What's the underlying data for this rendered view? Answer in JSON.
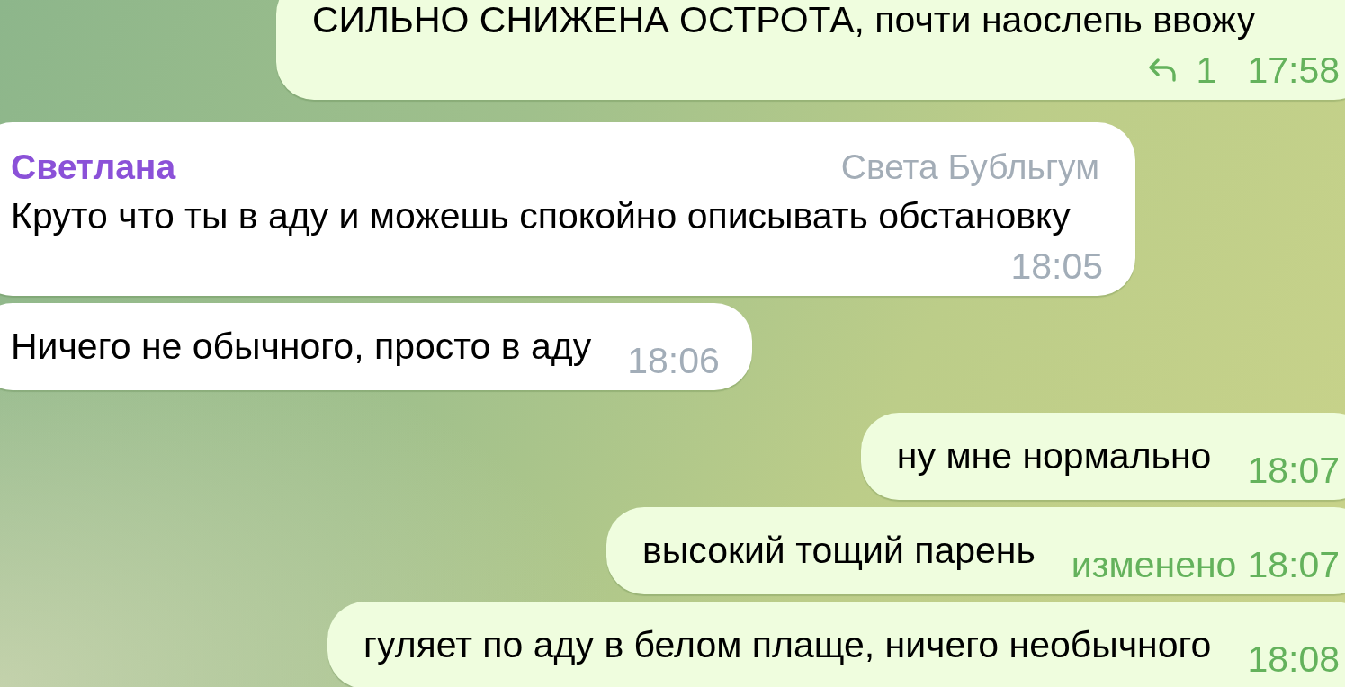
{
  "messages": [
    {
      "kind": "outgoing",
      "text": "СИЛЬНО СНИЖЕНА ОСТРОТА, почти наослепь ввожу",
      "replies": "1",
      "time": "17:58"
    },
    {
      "kind": "incoming",
      "sender": "Светлана",
      "sender_title": "Света Бубльгум",
      "text": "Круто что ты в аду и можешь спокойно описывать обстановку",
      "time": "18:05"
    },
    {
      "kind": "incoming",
      "text": "Ничего не обычного, просто в аду",
      "time": "18:06"
    },
    {
      "kind": "outgoing",
      "text": "ну мне нормально",
      "time": "18:07"
    },
    {
      "kind": "outgoing",
      "text": "высокий тощий парень",
      "edited_label": "изменено",
      "time": "18:07"
    },
    {
      "kind": "outgoing",
      "text": "гуляет по аду в белом плаще, ничего необычного",
      "time": "18:08"
    }
  ]
}
